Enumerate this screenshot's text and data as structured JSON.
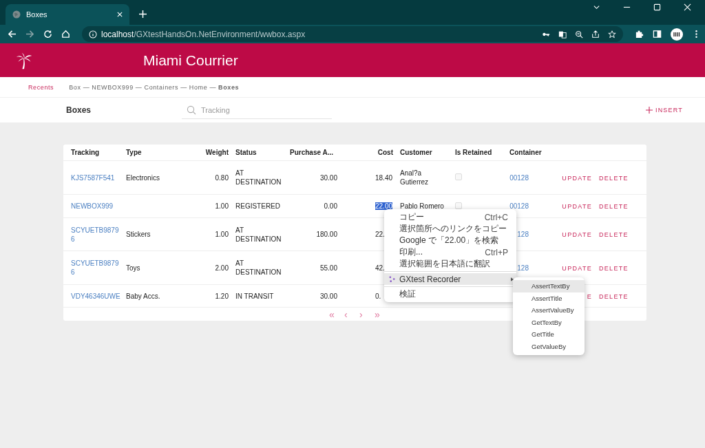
{
  "browser": {
    "tab_title": "Boxes",
    "url_host": "localhost",
    "url_path": "/GXtestHandsOn.NetEnvironment/wwbox.aspx"
  },
  "header": {
    "title": "Miami Courrier"
  },
  "breadcrumb": {
    "recents": "Recents",
    "path": "Box — NEWBOX999 — Containers — Home — **Boxes**"
  },
  "toolbar": {
    "title": "Boxes",
    "search": {
      "placeholder": "Tracking"
    },
    "insert": "INSERT"
  },
  "table": {
    "columns": [
      "Tracking",
      "Type",
      "Weight",
      "Status",
      "Purchase A...",
      "Cost",
      "Customer",
      "Is Retained",
      "Container"
    ],
    "rows": [
      {
        "tracking": "KJS7587F541",
        "type": "Electronics",
        "weight": "0.80",
        "status": "AT DESTINATION",
        "purchase": "30.00",
        "cost": "18.40",
        "cost_selected": false,
        "customer": "Anal?a Gutierrez",
        "retained": {
          "checked": false
        },
        "container": "00128",
        "update": "UPDATE",
        "delete": "DELETE"
      },
      {
        "tracking": "NEWBOX999",
        "weight": "1.00",
        "status": "REGISTERED",
        "purchase": "0.00",
        "cost": "22.00",
        "cost_selected": true,
        "customer": "Pablo Romero",
        "retained": {
          "checked": false
        },
        "container": "00128",
        "update": "UPDATE",
        "delete": "DELETE"
      },
      {
        "tracking": "SCYUETB98796",
        "type": "Stickers",
        "weight": "1.00",
        "status": "AT DESTINATION",
        "purchase": "180.00",
        "cost": "22.",
        "cost_selected": false,
        "container": "128",
        "update": "UPDATE",
        "delete": "DELETE"
      },
      {
        "tracking": "SCYUETB98796",
        "type": "Toys",
        "weight": "2.00",
        "status": "AT DESTINATION",
        "purchase": "55.00",
        "cost": "42.",
        "cost_selected": false,
        "container": "128",
        "update": "UPDATE",
        "delete": "DELETE"
      },
      {
        "tracking": "VDY46346UWE",
        "type": "Baby Accs.",
        "weight": "1.20",
        "status": "IN TRANSIT",
        "purchase": "30.00",
        "cost": "0.",
        "cost_selected": false,
        "update": "E",
        "delete": "DELETE"
      }
    ]
  },
  "pager": [
    "«",
    "‹",
    "›",
    "»"
  ],
  "context_menu": {
    "items": [
      {
        "kind": "item",
        "label": "コピー",
        "shortcut": "Ctrl+C",
        "selected": false
      },
      {
        "kind": "item",
        "label": "選択箇所へのリンクをコピー",
        "selected": false
      },
      {
        "kind": "item",
        "label": "Google で「22.00」を検索",
        "selected": false
      },
      {
        "kind": "item",
        "label": "印刷...",
        "shortcut": "Ctrl+P",
        "selected": false
      },
      {
        "kind": "item",
        "label": "選択範囲を日本語に翻訳",
        "selected": false
      },
      {
        "kind": "separator"
      },
      {
        "kind": "submenu",
        "label": "GXtest Recorder",
        "selected": true
      },
      {
        "kind": "separator"
      },
      {
        "kind": "item",
        "label": "検証",
        "selected": false
      }
    ]
  },
  "submenu": {
    "items": [
      {
        "label": "AssertTextBy",
        "selected": true
      },
      {
        "label": "AssertTitle",
        "selected": false
      },
      {
        "label": "AssertValueBy",
        "selected": false
      },
      {
        "label": "GetTextBy",
        "selected": false
      },
      {
        "label": "GetTitle",
        "selected": false
      },
      {
        "label": "GetValueBy",
        "selected": false
      }
    ]
  }
}
